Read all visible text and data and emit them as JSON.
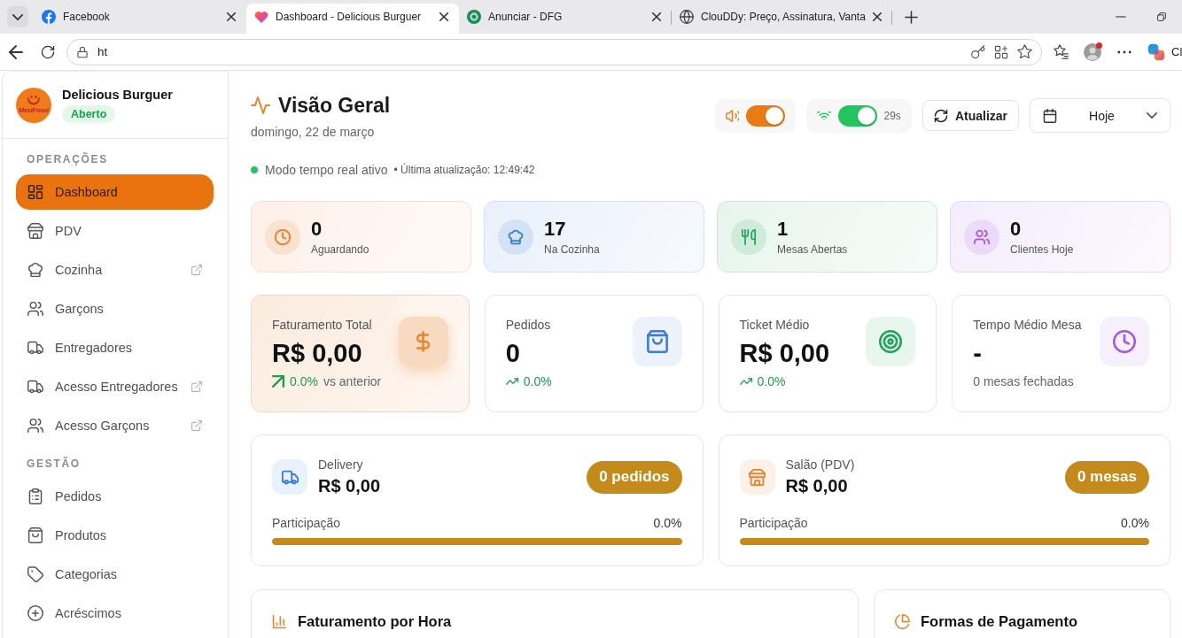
{
  "browser": {
    "tabs": [
      {
        "title": "Facebook",
        "selected": false
      },
      {
        "title": "Dashboard - Delicious Burguer",
        "selected": true
      },
      {
        "title": "Anunciar - DFG",
        "selected": false
      },
      {
        "title": "ClouDDy: Preço, Assinatura, Vanta",
        "selected": false
      }
    ],
    "address": "ht",
    "profile_notification": true,
    "edge_label": "Cl"
  },
  "sidebar": {
    "restaurant": {
      "name": "Delicious Burguer",
      "logo_text": "MeuFood",
      "status": "Aberto",
      "open": true
    },
    "sections": [
      {
        "title": "OPERAÇÕES",
        "items": [
          {
            "label": "Dashboard",
            "selected": true,
            "external": false
          },
          {
            "label": "PDV",
            "selected": false,
            "external": false
          },
          {
            "label": "Cozinha",
            "selected": false,
            "external": true
          },
          {
            "label": "Garçons",
            "selected": false,
            "external": false
          },
          {
            "label": "Entregadores",
            "selected": false,
            "external": false
          },
          {
            "label": "Acesso Entregadores",
            "selected": false,
            "external": true
          },
          {
            "label": "Acesso Garçons",
            "selected": false,
            "external": true
          }
        ]
      },
      {
        "title": "GESTÃO",
        "items": [
          {
            "label": "Pedidos",
            "selected": false,
            "external": false
          },
          {
            "label": "Produtos",
            "selected": false,
            "external": false
          },
          {
            "label": "Categorias",
            "selected": false,
            "external": false
          },
          {
            "label": "Acréscimos",
            "selected": false,
            "external": false
          }
        ]
      }
    ]
  },
  "header": {
    "title": "Visão Geral",
    "date": "domingo, 22 de março",
    "sound": {
      "on": true
    },
    "realtime": {
      "on": true,
      "countdown": "29s"
    },
    "refresh_button": "Atualizar",
    "period": "Hoje",
    "status": {
      "live": true,
      "text": "Modo tempo real ativo",
      "last_update": "• Última atualização: 12:49:42"
    }
  },
  "summary": [
    {
      "value": "0",
      "label": "Aguardando",
      "color": "#ea7c2c"
    },
    {
      "value": "17",
      "label": "Na Cozinha",
      "color": "#3b7dd8"
    },
    {
      "value": "1",
      "label": "Mesas Abertas",
      "color": "#22a55b"
    },
    {
      "value": "0",
      "label": "Clientes Hoje",
      "color": "#a25ae0"
    }
  ],
  "metrics": [
    {
      "label": "Faturamento Total",
      "value": "R$ 0,00",
      "change": "0.0%",
      "note": "vs anterior",
      "highlighted": true,
      "color": "#e8832f"
    },
    {
      "label": "Pedidos",
      "value": "0",
      "change": "0.0%",
      "highlighted": false,
      "color": "#3b7dd8"
    },
    {
      "label": "Ticket Médio",
      "value": "R$ 0,00",
      "change": "0.0%",
      "highlighted": false,
      "color": "#22a55b"
    },
    {
      "label": "Tempo Médio Mesa",
      "value": "-",
      "note": "0 mesas fechadas",
      "highlighted": false,
      "color": "#a25ae0"
    }
  ],
  "channels": [
    {
      "label": "Delivery",
      "value": "R$ 0,00",
      "badge": "0 pedidos",
      "share_label": "Participação",
      "share": "0.0%",
      "level": 1,
      "color": "#3b7dd8"
    },
    {
      "label": "Salão (PDV)",
      "value": "R$ 0,00",
      "badge": "0 mesas",
      "share_label": "Participação",
      "share": "0.0%",
      "level": 1,
      "color": "#e8832f"
    }
  ],
  "panels": [
    {
      "title": "Faturamento por Hora",
      "kind": "bar"
    },
    {
      "title": "Formas de Pagamento",
      "kind": "pie"
    }
  ]
}
